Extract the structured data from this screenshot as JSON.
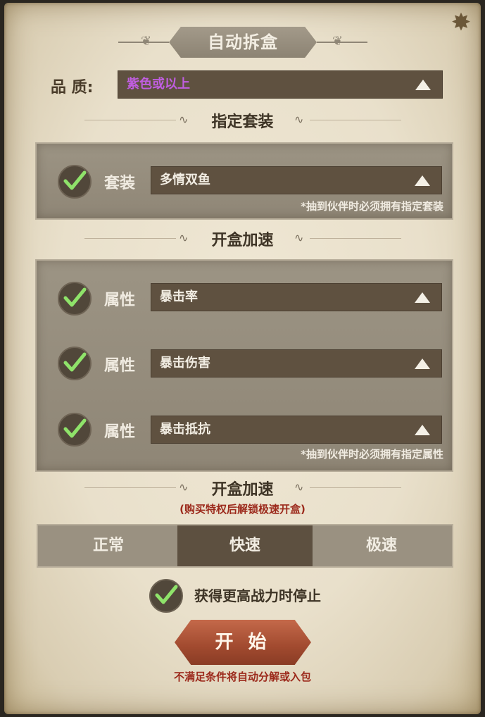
{
  "title": "自动拆盒",
  "quality": {
    "label": "品 质:",
    "value": "紫色或以上",
    "value_color": "#c05ee0"
  },
  "set_section": {
    "heading": "指定套装",
    "row": {
      "label": "套装",
      "value": "多情双鱼",
      "checked": true
    },
    "note": "*抽到伙伴时必须拥有指定套装"
  },
  "speed_attr_section": {
    "heading": "开盒加速",
    "rows": [
      {
        "label": "属性",
        "value": "暴击率",
        "checked": true
      },
      {
        "label": "属性",
        "value": "暴击伤害",
        "checked": true
      },
      {
        "label": "属性",
        "value": "暴击抵抗",
        "checked": true
      }
    ],
    "note": "*抽到伙伴时必须拥有指定属性"
  },
  "speed_section": {
    "heading": "开盒加速",
    "unlock_note": "(购买特权后解锁极速开盒)",
    "options": [
      "正常",
      "快速",
      "极速"
    ],
    "selected": "快速"
  },
  "stop_option": {
    "label": "获得更高战力时停止",
    "checked": true
  },
  "start_button": "开 始",
  "footer_note": "不满足条件将自动分解或入包",
  "colors": {
    "check": "#8fe36a",
    "dropdown": "#5f5140",
    "warning": "#9c2a1c",
    "button": "#a14a2f"
  }
}
